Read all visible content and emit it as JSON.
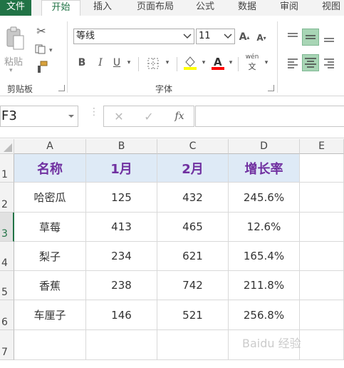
{
  "ribbon_tabs": [
    "文件",
    "开始",
    "插入",
    "页面布局",
    "公式",
    "数据",
    "审阅",
    "视图"
  ],
  "clipboard": {
    "paste_label": "粘贴",
    "group_label": "剪贴板"
  },
  "font": {
    "name": "等线",
    "size": "11",
    "group_label": "字体",
    "bold": "B",
    "italic": "I",
    "underline": "U",
    "phonetic": "wén"
  },
  "formula_bar": {
    "cell_ref": "F3",
    "fx": "fx",
    "value": ""
  },
  "columns": [
    "A",
    "B",
    "C",
    "D",
    "E"
  ],
  "rows": [
    "1",
    "2",
    "3",
    "4",
    "5",
    "6",
    "7"
  ],
  "selected_row": "3",
  "table": {
    "header": [
      "名称",
      "1月",
      "2月",
      "增长率"
    ],
    "rows": [
      [
        "哈密瓜",
        "125",
        "432",
        "245.6%"
      ],
      [
        "草莓",
        "413",
        "465",
        "12.6%"
      ],
      [
        "梨子",
        "234",
        "621",
        "165.4%"
      ],
      [
        "香蕉",
        "238",
        "742",
        "211.8%"
      ],
      [
        "车厘子",
        "146",
        "521",
        "256.8%"
      ]
    ]
  },
  "colors": {
    "excel_green": "#217346",
    "header_fill": "#deeaf6",
    "header_text": "#7030a0",
    "highlight_yellow": "#ffff00",
    "font_red": "#ff0000"
  },
  "watermark": "Baidu 经验"
}
